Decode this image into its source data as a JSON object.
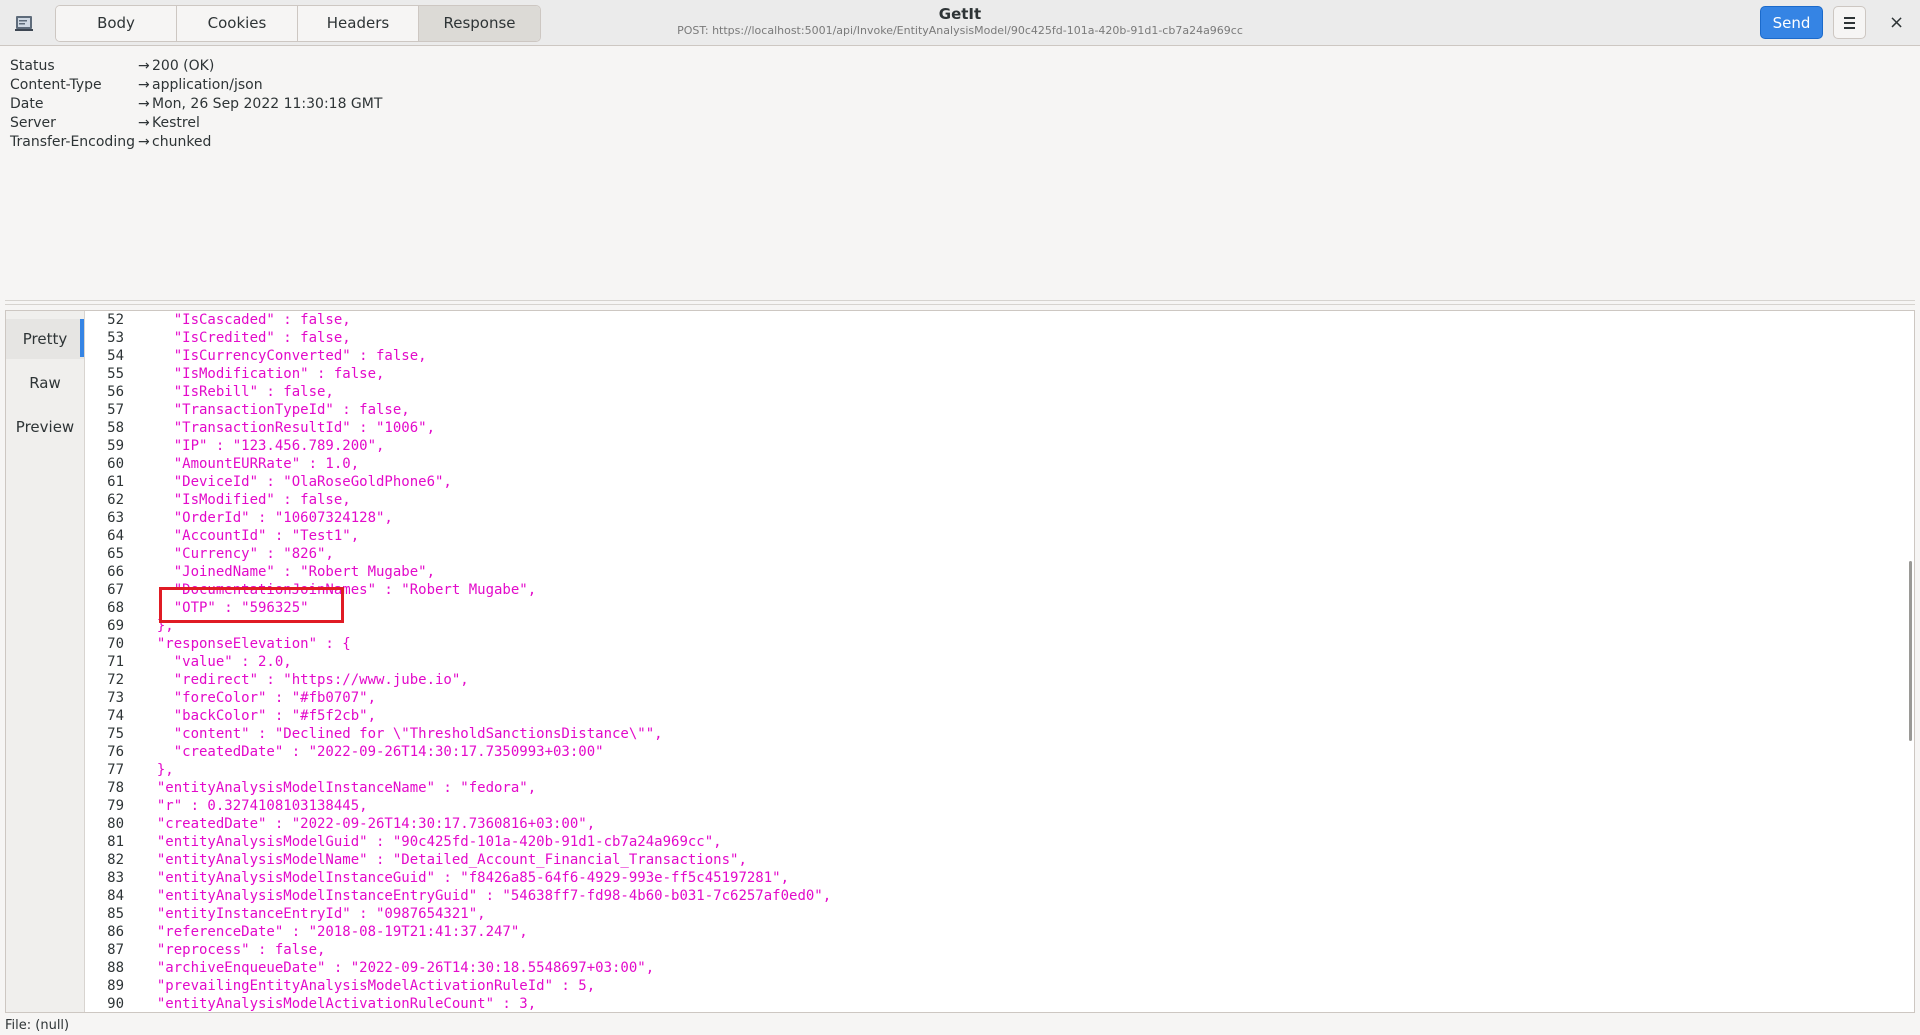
{
  "window": {
    "title": "GetIt",
    "subtitle": "POST: https://localhost:5001/api/Invoke/EntityAnalysisModel/90c425fd-101a-420b-91d1-cb7a24a969cc"
  },
  "tabs": [
    "Body",
    "Cookies",
    "Headers",
    "Response"
  ],
  "active_tab": "Response",
  "toolbar": {
    "send_label": "Send",
    "close_label": "×",
    "app_icon": "app-icon",
    "menu_icon": "hamburger-menu-icon"
  },
  "response_headers": [
    {
      "name": "Status",
      "value": "200 (OK)"
    },
    {
      "name": "Content-Type",
      "value": "application/json"
    },
    {
      "name": "Date",
      "value": "Mon, 26 Sep 2022 11:30:18 GMT"
    },
    {
      "name": "Server",
      "value": "Kestrel"
    },
    {
      "name": "Transfer-Encoding",
      "value": "chunked"
    }
  ],
  "header_arrow": "→",
  "view_modes": [
    "Pretty",
    "Raw",
    "Preview"
  ],
  "active_view_mode": "Pretty",
  "code_lines": [
    {
      "n": "52",
      "t": "    \"IsCascaded\" : false,"
    },
    {
      "n": "53",
      "t": "    \"IsCredited\" : false,"
    },
    {
      "n": "54",
      "t": "    \"IsCurrencyConverted\" : false,"
    },
    {
      "n": "55",
      "t": "    \"IsModification\" : false,"
    },
    {
      "n": "56",
      "t": "    \"IsRebill\" : false,"
    },
    {
      "n": "57",
      "t": "    \"TransactionTypeId\" : false,"
    },
    {
      "n": "58",
      "t": "    \"TransactionResultId\" : \"1006\","
    },
    {
      "n": "59",
      "t": "    \"IP\" : \"123.456.789.200\","
    },
    {
      "n": "60",
      "t": "    \"AmountEURRate\" : 1.0,"
    },
    {
      "n": "61",
      "t": "    \"DeviceId\" : \"OlaRoseGoldPhone6\","
    },
    {
      "n": "62",
      "t": "    \"IsModified\" : false,"
    },
    {
      "n": "63",
      "t": "    \"OrderId\" : \"10607324128\","
    },
    {
      "n": "64",
      "t": "    \"AccountId\" : \"Test1\","
    },
    {
      "n": "65",
      "t": "    \"Currency\" : \"826\","
    },
    {
      "n": "66",
      "t": "    \"JoinedName\" : \"Robert Mugabe\","
    },
    {
      "n": "67",
      "t": "    \"DocumentationJoinNames\" : \"Robert Mugabe\","
    },
    {
      "n": "68",
      "t": "    \"OTP\" : \"596325\""
    },
    {
      "n": "69",
      "t": "  },"
    },
    {
      "n": "70",
      "t": "  \"responseElevation\" : {"
    },
    {
      "n": "71",
      "t": "    \"value\" : 2.0,"
    },
    {
      "n": "72",
      "t": "    \"redirect\" : \"https://www.jube.io\","
    },
    {
      "n": "73",
      "t": "    \"foreColor\" : \"#fb0707\","
    },
    {
      "n": "74",
      "t": "    \"backColor\" : \"#f5f2cb\","
    },
    {
      "n": "75",
      "t": "    \"content\" : \"Declined for \\\"ThresholdSanctionsDistance\\\"\","
    },
    {
      "n": "76",
      "t": "    \"createdDate\" : \"2022-09-26T14:30:17.7350993+03:00\""
    },
    {
      "n": "77",
      "t": "  },"
    },
    {
      "n": "78",
      "t": "  \"entityAnalysisModelInstanceName\" : \"fedora\","
    },
    {
      "n": "79",
      "t": "  \"r\" : 0.3274108103138445,"
    },
    {
      "n": "80",
      "t": "  \"createdDate\" : \"2022-09-26T14:30:17.7360816+03:00\","
    },
    {
      "n": "81",
      "t": "  \"entityAnalysisModelGuid\" : \"90c425fd-101a-420b-91d1-cb7a24a969cc\","
    },
    {
      "n": "82",
      "t": "  \"entityAnalysisModelName\" : \"Detailed_Account_Financial_Transactions\","
    },
    {
      "n": "83",
      "t": "  \"entityAnalysisModelInstanceGuid\" : \"f8426a85-64f6-4929-993e-ff5c45197281\","
    },
    {
      "n": "84",
      "t": "  \"entityAnalysisModelInstanceEntryGuid\" : \"54638ff7-fd98-4b60-b031-7c6257af0ed0\","
    },
    {
      "n": "85",
      "t": "  \"entityInstanceEntryId\" : \"0987654321\","
    },
    {
      "n": "86",
      "t": "  \"referenceDate\" : \"2018-08-19T21:41:37.247\","
    },
    {
      "n": "87",
      "t": "  \"reprocess\" : false,"
    },
    {
      "n": "88",
      "t": "  \"archiveEnqueueDate\" : \"2022-09-26T14:30:18.5548697+03:00\","
    },
    {
      "n": "89",
      "t": "  \"prevailingEntityAnalysisModelActivationRuleId\" : 5,"
    },
    {
      "n": "90",
      "t": "  \"entityAnalysisModelActivationRuleCount\" : 3,"
    }
  ],
  "status": {
    "file_label": "File: (null)"
  },
  "colors": {
    "accent": "#3584e4",
    "json_text": "#e30aca",
    "highlight_box": "#e01b24"
  }
}
